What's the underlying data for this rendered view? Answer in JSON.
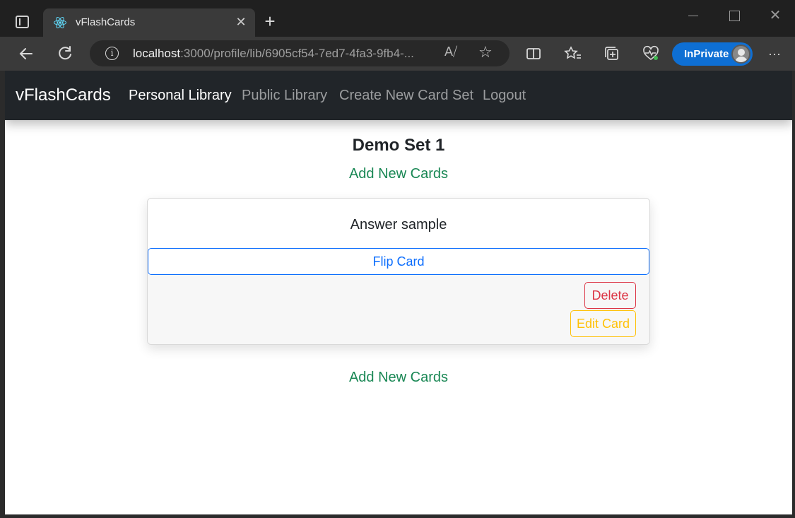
{
  "browser": {
    "tab_title": "vFlashCards",
    "tab_close": "✕",
    "new_tab": "+",
    "url_host": "localhost",
    "url_rest": ":3000/profile/lib/6905cf54-7ed7-4fa3-9fb4-...",
    "inprivate_label": "InPrivate",
    "icons": [
      "sidebar-toggle-icon",
      "react-icon",
      "back-icon",
      "refresh-icon",
      "info-icon",
      "read-aloud-icon",
      "favorite-star-icon",
      "split-screen-icon",
      "favorites-icon",
      "collections-icon",
      "browser-essentials-icon",
      "more-icon"
    ]
  },
  "nav": {
    "brand": "vFlashCards",
    "links": [
      "Personal Library",
      "Public Library",
      "Create New Card Set",
      "Logout"
    ]
  },
  "main": {
    "set_title": "Demo Set 1",
    "add_cards_top": "Add New Cards",
    "add_cards_bottom": "Add New Cards",
    "card": {
      "text": "Answer sample",
      "flip_label": "Flip Card",
      "delete_label": "Delete",
      "edit_label": "Edit Card"
    }
  },
  "colors": {
    "navbar": "#212529",
    "success": "#198754",
    "primary": "#0d6efd",
    "danger": "#dc3545",
    "warning": "#ffc107"
  }
}
